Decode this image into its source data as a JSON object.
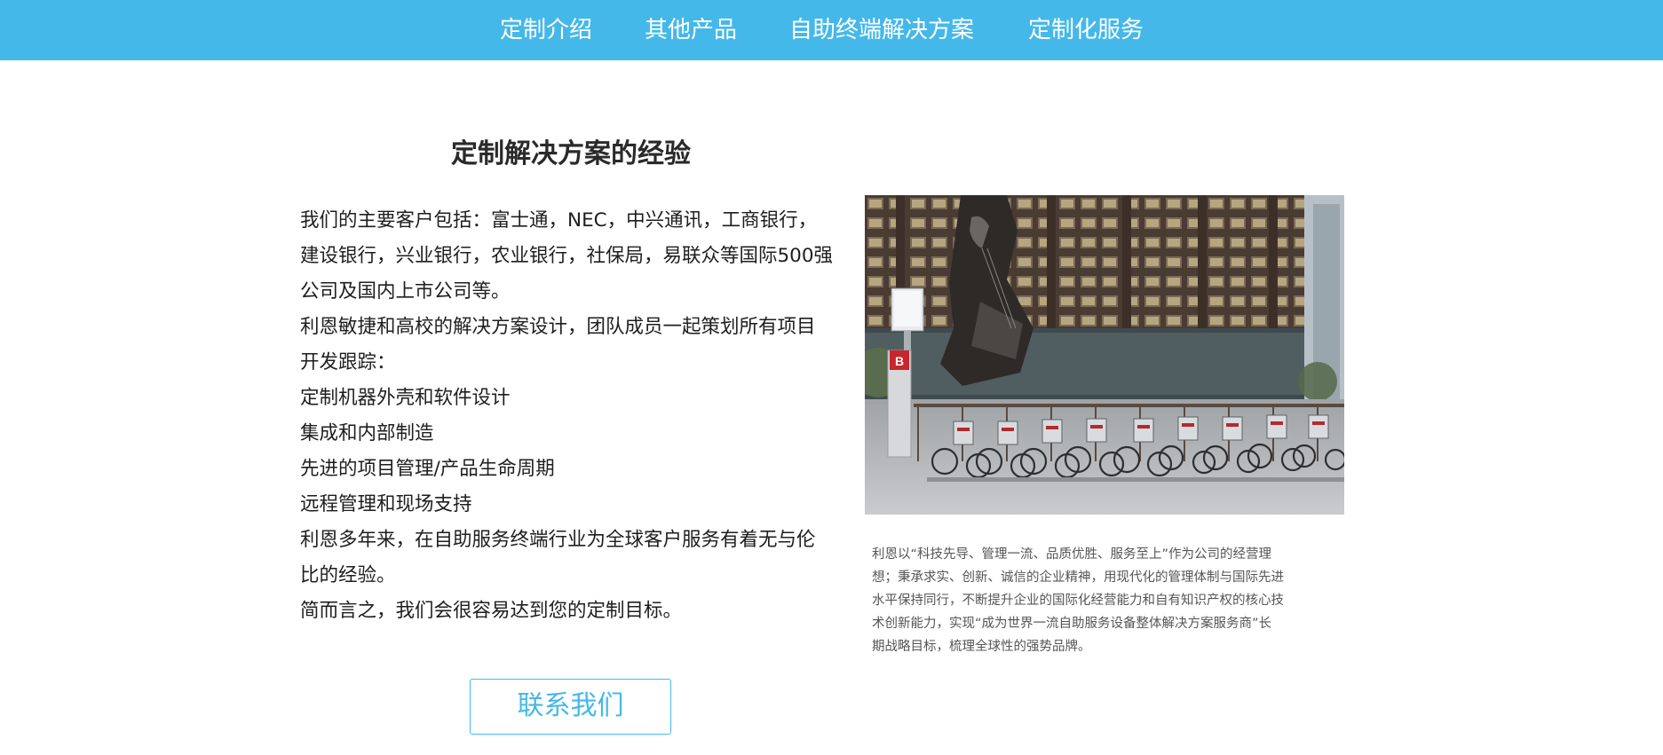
{
  "nav": {
    "items": [
      {
        "label": "定制介绍"
      },
      {
        "label": "其他产品"
      },
      {
        "label": "自助终端解决方案"
      },
      {
        "label": "定制化服务"
      }
    ]
  },
  "main": {
    "title": "定制解决方案的经验",
    "paragraph_lines": [
      "我们的主要客户包括：富士通，NEC，中兴通讯，工商银行，",
      "建设银行，兴业银行，农业银行，社保局，易联众等国际500强",
      "公司及国内上市公司等。",
      "利恩敏捷和高校的解决方案设计，团队成员一起策划所有项目",
      "开发跟踪：",
      "定制机器外壳和软件设计",
      "集成和内部制造",
      "先进的项目管理/产品生命周期",
      "远程管理和现场支持",
      "利恩多年来，在自助服务终端行业为全球客户服务有着无与伦",
      "比的经验。",
      "简而言之，我们会很容易达到您的定制目标。"
    ],
    "contact_button": "联系我们"
  },
  "side": {
    "photo_icon": "bike-share-station-photo",
    "station_sign": "B",
    "caption_lines": [
      "利恩以“科技先导、管理一流、品质优胜、服务至上”作为公司的经营理",
      "想；秉承求实、创新、诚信的企业精神，用现代化的管理体制与国际先进",
      "水平保持同行，不断提升企业的国际化经营能力和自有知识产权的核心技",
      "术创新能力，实现“成为世界一流自助服务设备整体解决方案服务商”长",
      "期战略目标，梳理全球性的强势品牌。"
    ]
  },
  "colors": {
    "accent": "#45b8ea",
    "nav_text": "#ffffff",
    "body_text": "#1e1e1e",
    "caption_text": "#555555"
  }
}
